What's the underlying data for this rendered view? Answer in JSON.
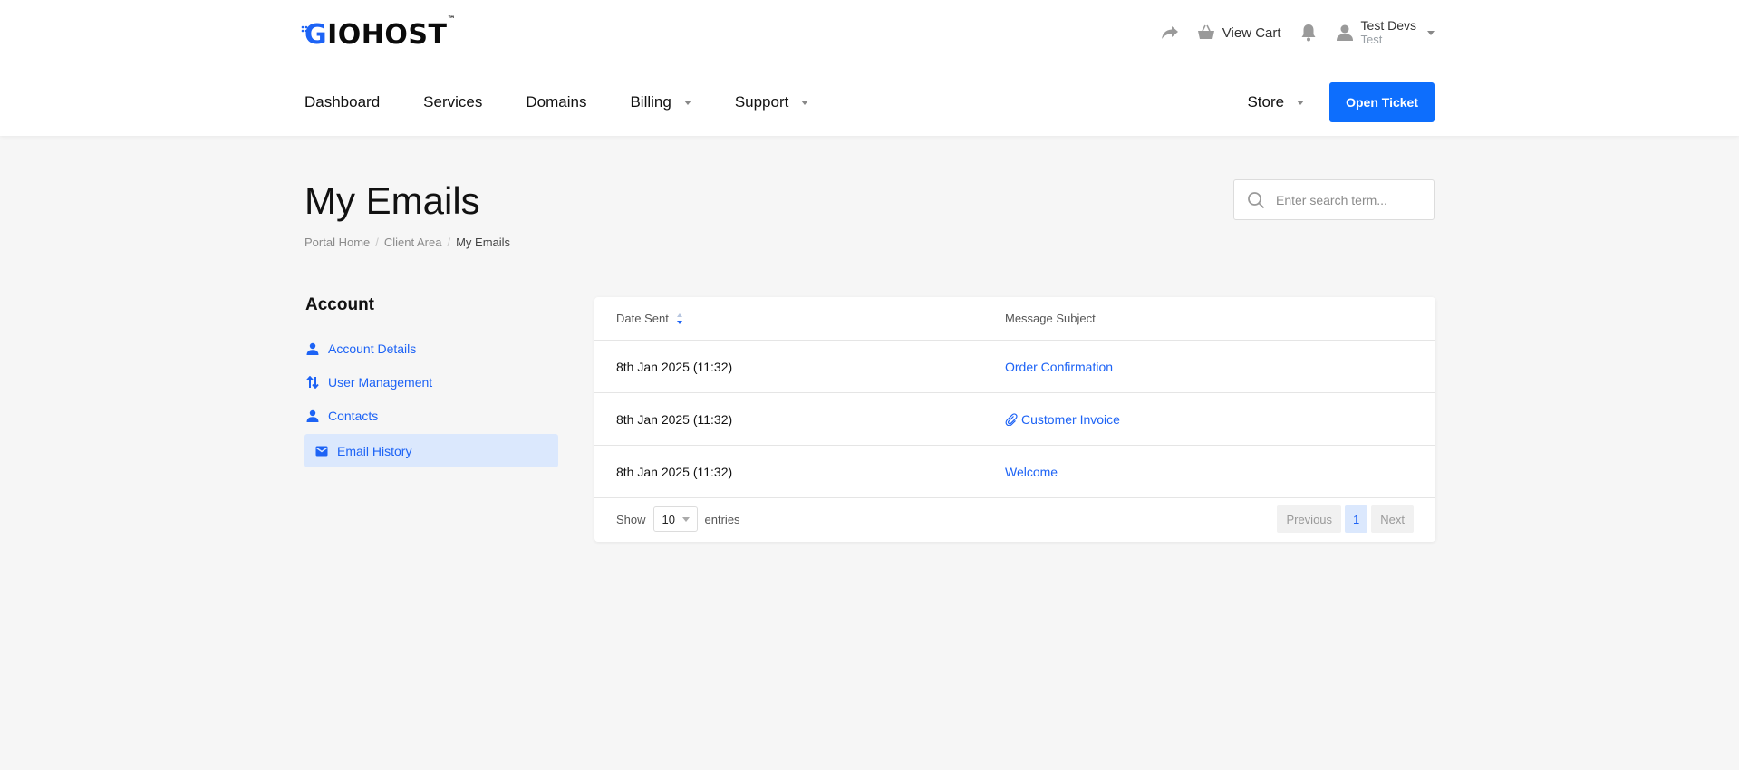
{
  "header": {
    "logo_text": "GIOHOST",
    "logo_tm": "™",
    "view_cart": "View Cart",
    "user_name": "Test Devs",
    "user_sub": "Test",
    "open_ticket": "Open Ticket",
    "brand_color": "#1d63f5"
  },
  "nav": {
    "items": [
      {
        "label": "Dashboard"
      },
      {
        "label": "Services"
      },
      {
        "label": "Domains"
      },
      {
        "label": "Billing"
      },
      {
        "label": "Support"
      }
    ],
    "store": "Store"
  },
  "page": {
    "title": "My Emails",
    "breadcrumb": [
      "Portal Home",
      "Client Area",
      "My Emails"
    ],
    "search_placeholder": "Enter search term..."
  },
  "sidebar": {
    "title": "Account",
    "items": [
      {
        "label": "Account Details",
        "icon": "user-icon"
      },
      {
        "label": "User Management",
        "icon": "arrows-icon"
      },
      {
        "label": "Contacts",
        "icon": "user-icon"
      },
      {
        "label": "Email History",
        "icon": "envelope-icon",
        "active": true
      }
    ]
  },
  "table": {
    "headers": {
      "date": "Date Sent",
      "subject": "Message Subject"
    },
    "rows": [
      {
        "date": "8th Jan 2025 (11:32)",
        "subject": "Order Confirmation",
        "attachment": false
      },
      {
        "date": "8th Jan 2025 (11:32)",
        "subject": "Customer Invoice",
        "attachment": true
      },
      {
        "date": "8th Jan 2025 (11:32)",
        "subject": "Welcome",
        "attachment": false
      }
    ],
    "show_label": "Show",
    "entries_label": "entries",
    "page_length": "10",
    "pager": {
      "previous": "Previous",
      "current": "1",
      "next": "Next"
    }
  }
}
